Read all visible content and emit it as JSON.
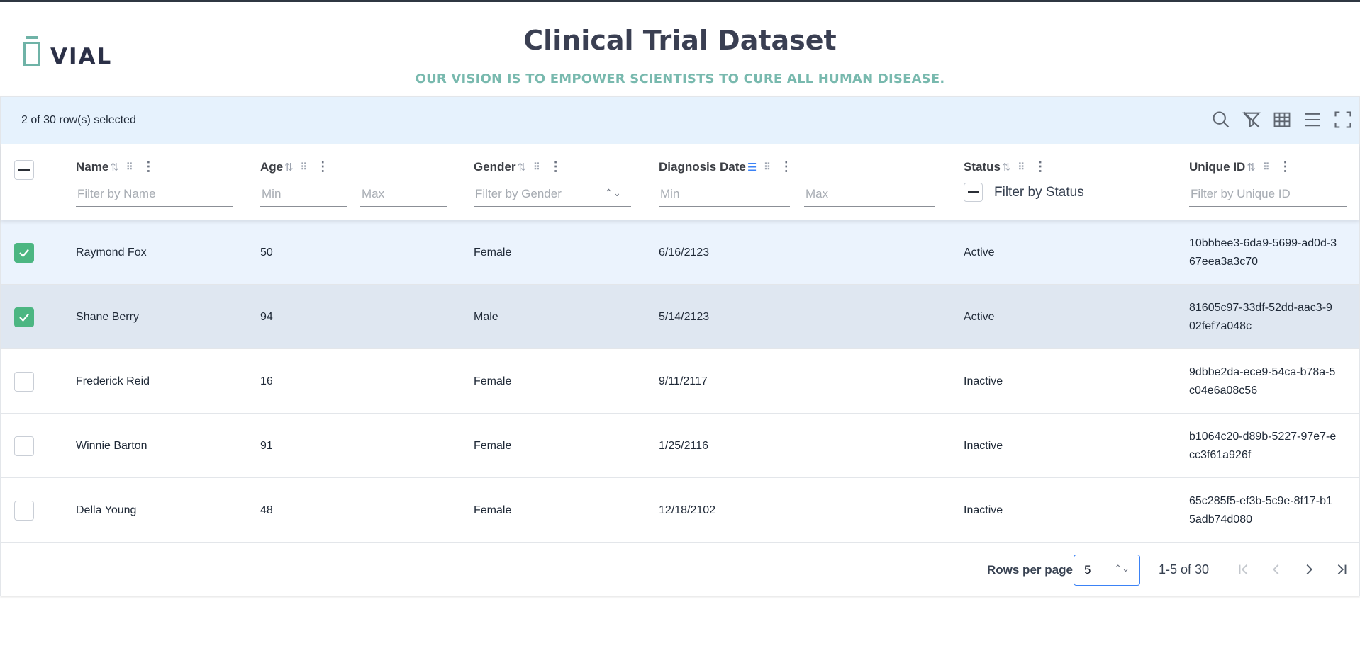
{
  "brand": {
    "logo_text": "VIAL"
  },
  "header": {
    "title": "Clinical Trial Dataset",
    "subtitle": "OUR VISION IS TO EMPOWER SCIENTISTS TO CURE ALL HUMAN DISEASE."
  },
  "toolbar": {
    "selection_text": "2 of 30 row(s) selected",
    "icons": [
      "search-icon",
      "filter-off-icon",
      "columns-icon",
      "density-icon",
      "fullscreen-icon"
    ]
  },
  "columns": [
    {
      "key": "name",
      "label": "Name",
      "filter_placeholder": "Filter by Name",
      "sort": "none"
    },
    {
      "key": "age",
      "label": "Age",
      "filter_min": "Min",
      "filter_max": "Max",
      "sort": "none"
    },
    {
      "key": "gender",
      "label": "Gender",
      "filter_placeholder": "Filter by Gender",
      "sort": "none"
    },
    {
      "key": "diagnosis",
      "label": "Diagnosis Date",
      "filter_min": "Min",
      "filter_max": "Max",
      "sort": "desc"
    },
    {
      "key": "status",
      "label": "Status",
      "filter_label": "Filter by Status",
      "sort": "none"
    },
    {
      "key": "uid",
      "label": "Unique ID",
      "filter_placeholder": "Filter by Unique ID",
      "sort": "none"
    }
  ],
  "rows": [
    {
      "selected": true,
      "name": "Raymond Fox",
      "age": "50",
      "gender": "Female",
      "diagnosis": "6/16/2123",
      "status": "Active",
      "uid": "10bbbee3-6da9-5699-ad0d-367eea3a3c70"
    },
    {
      "selected": true,
      "name": "Shane Berry",
      "age": "94",
      "gender": "Male",
      "diagnosis": "5/14/2123",
      "status": "Active",
      "uid": "81605c97-33df-52dd-aac3-902fef7a048c"
    },
    {
      "selected": false,
      "name": "Frederick Reid",
      "age": "16",
      "gender": "Female",
      "diagnosis": "9/11/2117",
      "status": "Inactive",
      "uid": "9dbbe2da-ece9-54ca-b78a-5c04e6a08c56"
    },
    {
      "selected": false,
      "name": "Winnie Barton",
      "age": "91",
      "gender": "Female",
      "diagnosis": "1/25/2116",
      "status": "Inactive",
      "uid": "b1064c20-d89b-5227-97e7-ecc3f61a926f"
    },
    {
      "selected": false,
      "name": "Della Young",
      "age": "48",
      "gender": "Female",
      "diagnosis": "12/18/2102",
      "status": "Inactive",
      "uid": "65c285f5-ef3b-5c9e-8f17-b15adb74d080"
    }
  ],
  "pagination": {
    "rows_per_page_label": "Rows per page",
    "rows_per_page": "5",
    "range_text": "1-5 of 30"
  },
  "colors": {
    "accent": "#4cb682",
    "brand": "#78b9ae",
    "toolbar_bg": "#e6f2fd",
    "selected_row": "#ebf3fd"
  }
}
